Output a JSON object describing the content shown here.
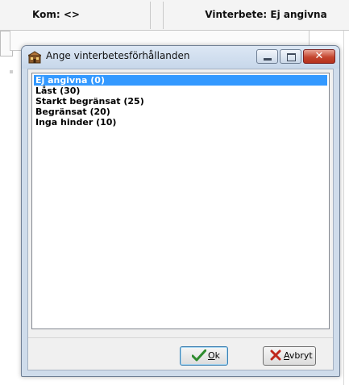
{
  "background": {
    "columns": [
      {
        "label": "Kom: <>"
      },
      {
        "label": "Vinterbete: Ej angivna"
      }
    ]
  },
  "dialog": {
    "title": "Ange vinterbetesförhållanden",
    "icon": "app-building-icon",
    "window_buttons": {
      "minimize": "minimize-icon",
      "maximize": "maximize-icon",
      "close": "close-icon"
    },
    "list": {
      "items": [
        {
          "label": "Ej angivna (0)",
          "selected": true
        },
        {
          "label": "Låst (30)",
          "selected": false
        },
        {
          "label": "Starkt begränsat (25)",
          "selected": false
        },
        {
          "label": "Begränsat (20)",
          "selected": false
        },
        {
          "label": "Inga hinder (10)",
          "selected": false
        }
      ]
    },
    "buttons": {
      "ok": {
        "mnemonic": "O",
        "rest": "k",
        "icon": "checkmark-icon",
        "icon_color": "#2e8b2e"
      },
      "cancel": {
        "mnemonic": "A",
        "rest": "vbryt",
        "icon": "x-icon",
        "icon_color": "#c0281c"
      }
    },
    "accent_colors": {
      "selection": "#3399ff",
      "close_button": "#c4462f"
    }
  }
}
